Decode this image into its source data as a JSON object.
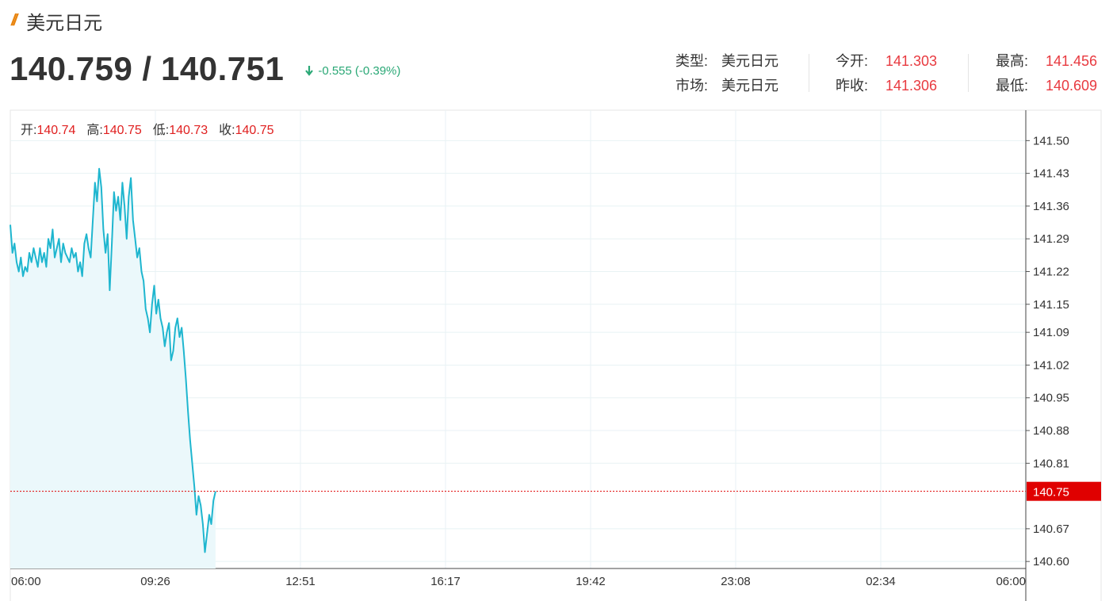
{
  "header": {
    "title_mark": "//",
    "title": "美元日元",
    "bid": "140.759",
    "separator": "/",
    "ask": "140.751",
    "change": "-0.555",
    "change_pct": "(-0.39%)",
    "change_icon": "arrow-down-icon"
  },
  "info": {
    "type_label": "类型:",
    "type_value": "美元日元",
    "market_label": "市场:",
    "market_value": "美元日元",
    "open_label": "今开:",
    "open_value": "141.303",
    "prev_close_label": "昨收:",
    "prev_close_value": "141.306",
    "high_label": "最高:",
    "high_value": "141.456",
    "low_label": "最低:",
    "low_value": "140.609"
  },
  "ohlc": {
    "open_label": "开:",
    "open_value": "140.74",
    "high_label": "高:",
    "high_value": "140.75",
    "low_label": "低:",
    "low_value": "140.73",
    "close_label": "收:",
    "close_value": "140.75"
  },
  "colors": {
    "line": "#1fb6cf",
    "area": "#ebf8fb",
    "current_price": "#e00000",
    "up_red": "#e8393f",
    "down_green": "#2aa876",
    "title_mark": "#e8830c"
  },
  "chart_data": {
    "type": "area",
    "x_ticks": [
      "06:00",
      "09:26",
      "12:51",
      "16:17",
      "19:42",
      "23:08",
      "02:34",
      "06:00"
    ],
    "y_ticks": [
      "141.50",
      "141.43",
      "141.36",
      "141.29",
      "141.22",
      "141.15",
      "141.09",
      "141.02",
      "140.95",
      "140.88",
      "140.81",
      "140.67",
      "140.60"
    ],
    "ylim": [
      140.585,
      141.565
    ],
    "x_unit": "minutes since 06:00",
    "xlim": [
      0,
      1440
    ],
    "current_price": 140.75,
    "current_price_label": "140.75",
    "grid": true,
    "series": [
      {
        "x": [
          0,
          3,
          6,
          9,
          12,
          15,
          18,
          21,
          24,
          27,
          30,
          33,
          36,
          39,
          42,
          45,
          48,
          51,
          54,
          57,
          60,
          63,
          66,
          69,
          72,
          75,
          78,
          81,
          84,
          87,
          90,
          93,
          96,
          99,
          102,
          105,
          108,
          111,
          114,
          117,
          120,
          123,
          126,
          129,
          132,
          135,
          138,
          141,
          144,
          147,
          150,
          153,
          156,
          159,
          162,
          165,
          168,
          171,
          174,
          177,
          180,
          183,
          186,
          189,
          192,
          195,
          198,
          201,
          204,
          207,
          210,
          213,
          216,
          219,
          222,
          225,
          228,
          231,
          234,
          237,
          240,
          243,
          246,
          249,
          252,
          255,
          258,
          261,
          264,
          267,
          270,
          273,
          276,
          279,
          282,
          285,
          288,
          291
        ],
        "y": [
          141.32,
          141.26,
          141.28,
          141.24,
          141.22,
          141.25,
          141.21,
          141.23,
          141.22,
          141.26,
          141.24,
          141.27,
          141.25,
          141.23,
          141.27,
          141.24,
          141.26,
          141.23,
          141.29,
          141.27,
          141.31,
          141.25,
          141.27,
          141.29,
          141.24,
          141.28,
          141.26,
          141.25,
          141.24,
          141.27,
          141.25,
          141.26,
          141.22,
          141.24,
          141.21,
          141.28,
          141.3,
          141.27,
          141.25,
          141.33,
          141.41,
          141.37,
          141.44,
          141.4,
          141.31,
          141.26,
          141.3,
          141.18,
          141.28,
          141.39,
          141.35,
          141.38,
          141.33,
          141.41,
          141.36,
          141.29,
          141.38,
          141.42,
          141.33,
          141.29,
          141.25,
          141.27,
          141.22,
          141.2,
          141.14,
          141.12,
          141.09,
          141.15,
          141.19,
          141.13,
          141.16,
          141.12,
          141.1,
          141.06,
          141.09,
          141.11,
          141.03,
          141.05,
          141.1,
          141.12,
          141.08,
          141.1,
          141.05,
          140.99,
          140.92,
          140.86,
          140.81,
          140.76,
          140.7,
          140.74,
          140.72,
          140.68,
          140.62,
          140.66,
          140.7,
          140.68,
          140.73,
          140.75
        ]
      }
    ]
  }
}
